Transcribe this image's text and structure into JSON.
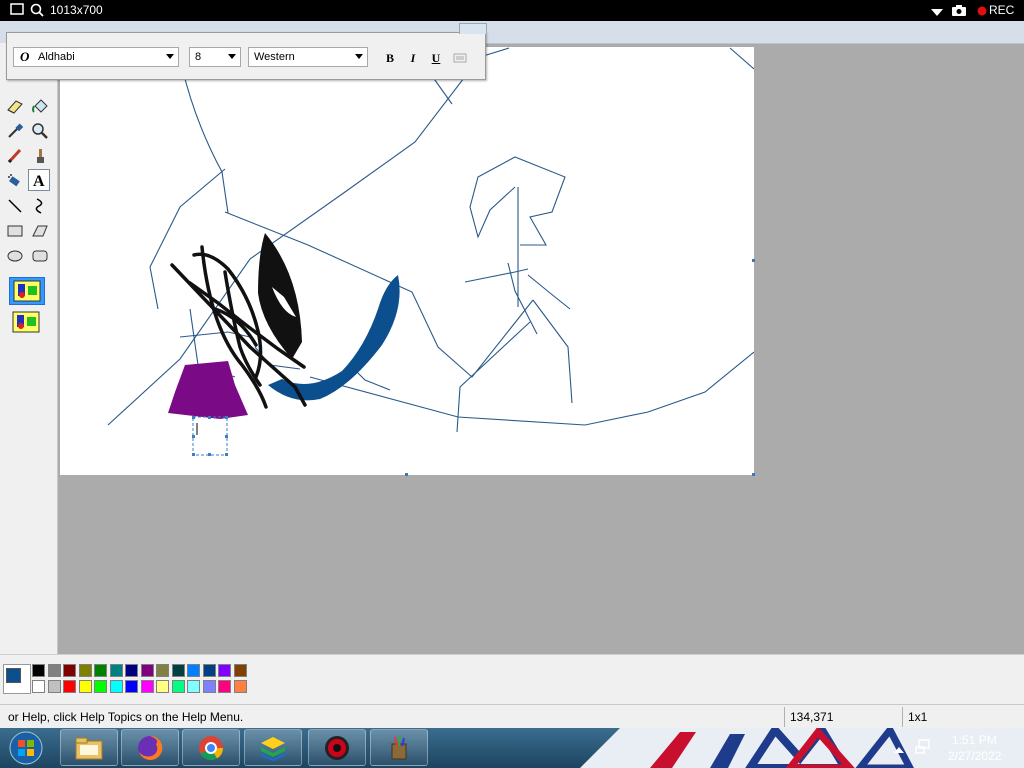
{
  "recorder": {
    "resolution": "1013x700",
    "rec_label": "REC"
  },
  "font_toolbar": {
    "font_name": "Aldhabi",
    "font_size": "8",
    "script": "Western",
    "bold_label": "B",
    "italic_label": "I",
    "underline_label": "U"
  },
  "toolbox": {
    "tools": [
      "eraser-icon",
      "fill-bucket-icon",
      "color-picker-icon",
      "magnifier-icon",
      "pencil-icon",
      "brush-icon",
      "airbrush-icon",
      "text-icon",
      "line-icon",
      "curve-icon",
      "rectangle-icon",
      "polygon-icon",
      "ellipse-icon",
      "rounded-rectangle-icon"
    ],
    "active_tool": "text-icon"
  },
  "palette": {
    "foreground": "#0b4f8e",
    "background": "#ffffff",
    "colors_row1": [
      "#000000",
      "#808080",
      "#800000",
      "#808000",
      "#008000",
      "#008080",
      "#000080",
      "#800080",
      "#808040",
      "#004040",
      "#0080ff",
      "#004080",
      "#8000ff",
      "#804000"
    ],
    "colors_row2": [
      "#ffffff",
      "#c0c0c0",
      "#ff0000",
      "#ffff00",
      "#00ff00",
      "#00ffff",
      "#0000ff",
      "#ff00ff",
      "#ffff80",
      "#00ff80",
      "#80ffff",
      "#8080ff",
      "#ff0080",
      "#ff8040"
    ]
  },
  "status": {
    "help_text": "or Help, click Help Topics on the Help Menu.",
    "coords": "134,371",
    "size": "1x1"
  },
  "taskbar": {
    "apps": [
      "start-orb-icon",
      "file-explorer-icon",
      "firefox-icon",
      "chrome-icon",
      "bluestacks-icon",
      "recorder-app-icon",
      "paint-icon"
    ],
    "time": "1:51 PM",
    "date": "2/27/2022"
  }
}
